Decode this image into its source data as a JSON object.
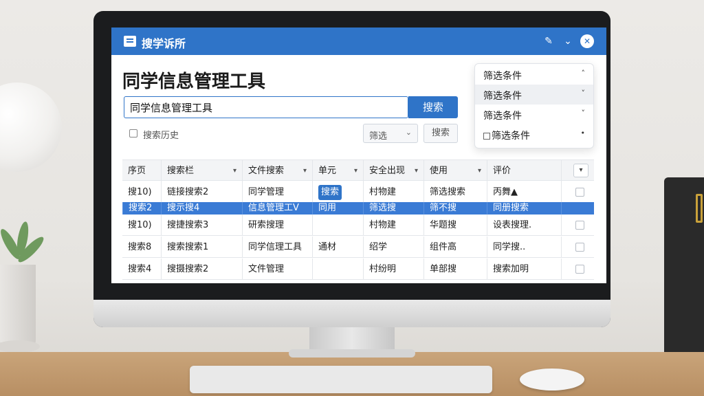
{
  "window": {
    "app_title": "搜学诉所",
    "edit_icon": "edit-icon",
    "collapse_icon": "chevron-down-icon",
    "close_icon": "close-icon",
    "close_symbol": "✕"
  },
  "main": {
    "page_title": "同学信息管理工具",
    "search": {
      "value": "同学信息管理工具",
      "button_label": "搜索"
    },
    "history_label": "搜索历史",
    "filter_select": {
      "label": "筛选"
    },
    "reset_label": "搜索"
  },
  "filter_panel": {
    "items": [
      {
        "label": "筛选条件",
        "chevron": "˄"
      },
      {
        "label": "筛选条件",
        "chevron": "˅"
      },
      {
        "label": "筛选条件",
        "chevron": "˅"
      },
      {
        "label": "筛选条件",
        "chevron": "•"
      }
    ]
  },
  "table": {
    "columns": [
      "序页",
      "搜索栏",
      "文件搜索",
      "单元",
      "安全出现",
      "使用",
      "评价",
      ""
    ],
    "rows": [
      [
        "搜10)",
        "链接搜索2",
        "同学管理",
        "搜索",
        "村物建",
        "筛选搜索",
        "丙舞▲",
        ""
      ],
      [
        "搜索2",
        "搜示搜4",
        "信息管理工V",
        "同用",
        "筛选搜",
        "筛不搜",
        "同册搜索",
        ""
      ],
      [
        "搜10)",
        "搜捷搜索3",
        "研索搜理",
        "",
        "村物建",
        "华题搜",
        "设表搜理.",
        ""
      ],
      [
        "搜索8",
        "搜索搜索1",
        "同学信理工具",
        "通材",
        "绍学",
        "组件高",
        "同学搜..",
        ""
      ],
      [
        "搜索4",
        "搜摄搜索2",
        "文件管理",
        "",
        "村纷明",
        "单部搜",
        "搜索加明",
        ""
      ]
    ],
    "selected_row": 1,
    "tag_row": 0
  },
  "colors": {
    "accent": "#2f74c8",
    "selected_row": "#3a7bd5"
  }
}
